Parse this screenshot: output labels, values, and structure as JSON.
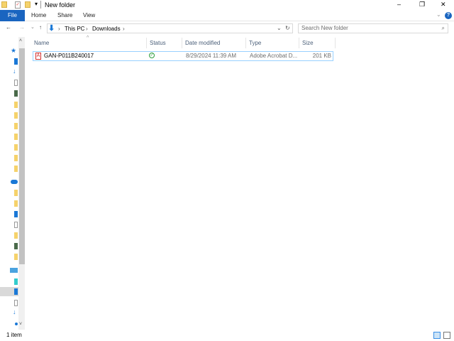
{
  "window": {
    "title": "New folder",
    "minimize": "–",
    "maximize": "❐",
    "close": "✕"
  },
  "ribbon": {
    "tabs": [
      "File",
      "Home",
      "Share",
      "View"
    ],
    "help": "?",
    "expand": "⌄"
  },
  "nav": {
    "back": "←",
    "forward": "→",
    "recent": "⌄",
    "up": "↑",
    "breadcrumb": [
      "This PC",
      "Downloads"
    ],
    "sep": "›",
    "refresh": "↻",
    "dropdown": "⌄"
  },
  "search": {
    "placeholder": "Search New folder",
    "icon": "⌕"
  },
  "columns": [
    "Name",
    "Status",
    "Date modified",
    "Type",
    "Size"
  ],
  "files": [
    {
      "name": "GAN-P011B240017",
      "status": "synced",
      "date": "8/29/2024 11:39 AM",
      "type": "Adobe Acrobat D...",
      "size": "201 KB"
    }
  ],
  "status_bar": {
    "count": "1 item"
  },
  "colors": {
    "accent": "#1a65c0",
    "selection": "#99d1ff",
    "sync_ok": "#2a9d3a",
    "pdf": "#d32f2f"
  },
  "nav_pane_icons": [
    "quick-access-star",
    "desktop",
    "downloads",
    "documents",
    "pictures",
    "folder",
    "folder",
    "folder",
    "folder",
    "folder",
    "folder",
    "folder",
    "onedrive",
    "folder",
    "folder",
    "desktop",
    "documents",
    "folder",
    "pictures",
    "folder",
    "this-pc",
    "3d-objects",
    "desktop",
    "documents",
    "downloads",
    "music"
  ]
}
